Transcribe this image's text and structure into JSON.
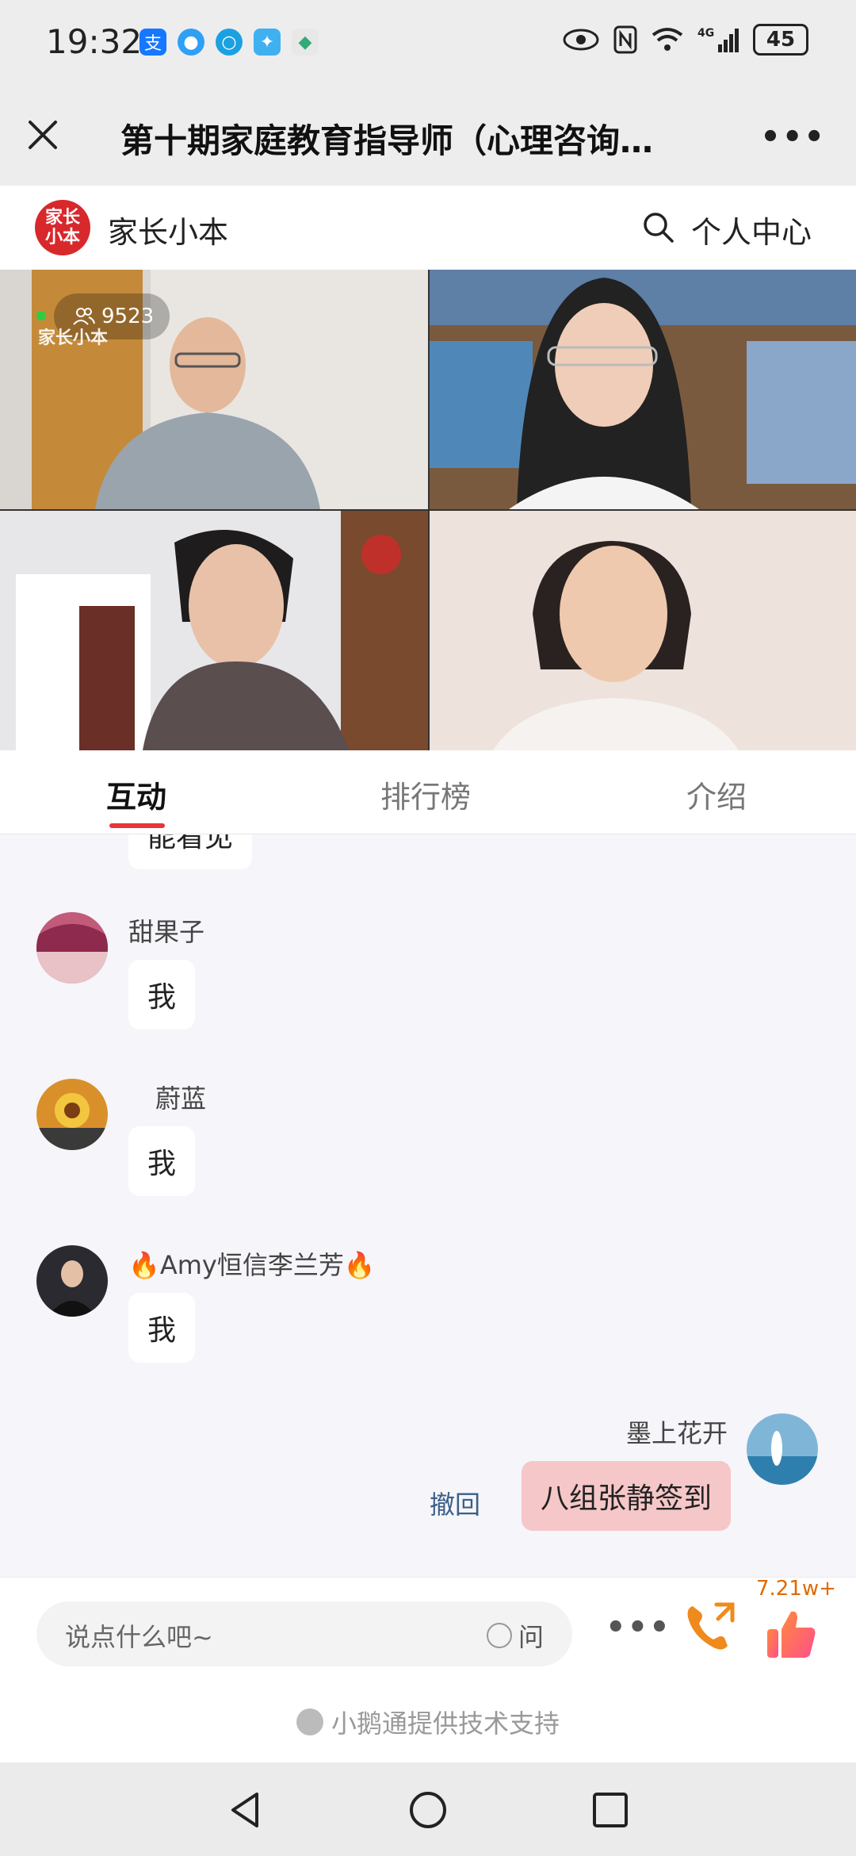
{
  "status_bar": {
    "time": "19:32",
    "battery": "45",
    "network": "4G"
  },
  "title_bar": {
    "title": "第十期家庭教育指导师（心理咨询…"
  },
  "brand_bar": {
    "logo_text": "家长小本",
    "name": "家长小本",
    "center_label": "个人中心"
  },
  "video": {
    "viewer_count": "9523",
    "watermark": "家长小本"
  },
  "tabs": [
    {
      "label": "互动",
      "active": true
    },
    {
      "label": "排行榜",
      "active": false
    },
    {
      "label": "介绍",
      "active": false
    }
  ],
  "chat": {
    "messages": [
      {
        "user": "",
        "text": "能看见",
        "partial": true
      },
      {
        "user": "甜果子",
        "text": "我"
      },
      {
        "user": "蔚蓝",
        "text": "我"
      },
      {
        "user": "🔥Amy恒信李兰芳🔥",
        "text": "我"
      }
    ],
    "self_message": {
      "user": "墨上花开",
      "text": "八组张静签到",
      "recall_label": "撤回"
    }
  },
  "input_bar": {
    "placeholder": "说点什么吧~",
    "ask_label": "问",
    "like_count": "7.21w+"
  },
  "footer": {
    "support_text": "小鹅通提供技术支持"
  },
  "colors": {
    "accent_red": "#e8343b",
    "self_bubble": "#f6c7c8",
    "like_orange": "#e06a00"
  }
}
